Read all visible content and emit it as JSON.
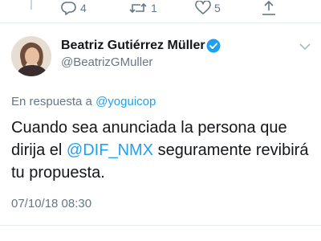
{
  "actions": {
    "reply_count": "4",
    "retweet_count": "1",
    "like_count": "5",
    "icons": [
      "reply-icon",
      "retweet-icon",
      "heart-icon",
      "share-icon"
    ]
  },
  "author": {
    "display_name": "Beatriz Gutiérrez Müller",
    "handle": "@BeatrizGMuller",
    "verified": true
  },
  "reply": {
    "prefix": "En respuesta a",
    "to": "@yoguicop"
  },
  "tweet": {
    "text_part1": "Cuando sea anunciada la persona que dirija el ",
    "mention": "@DIF_NMX",
    "text_part2": " seguramente revibirá tu propuesta."
  },
  "timestamp": "07/10/18 08:30",
  "colors": {
    "accent": "#1da1f2",
    "secondary_text": "#657786",
    "primary_text": "#14171a"
  }
}
